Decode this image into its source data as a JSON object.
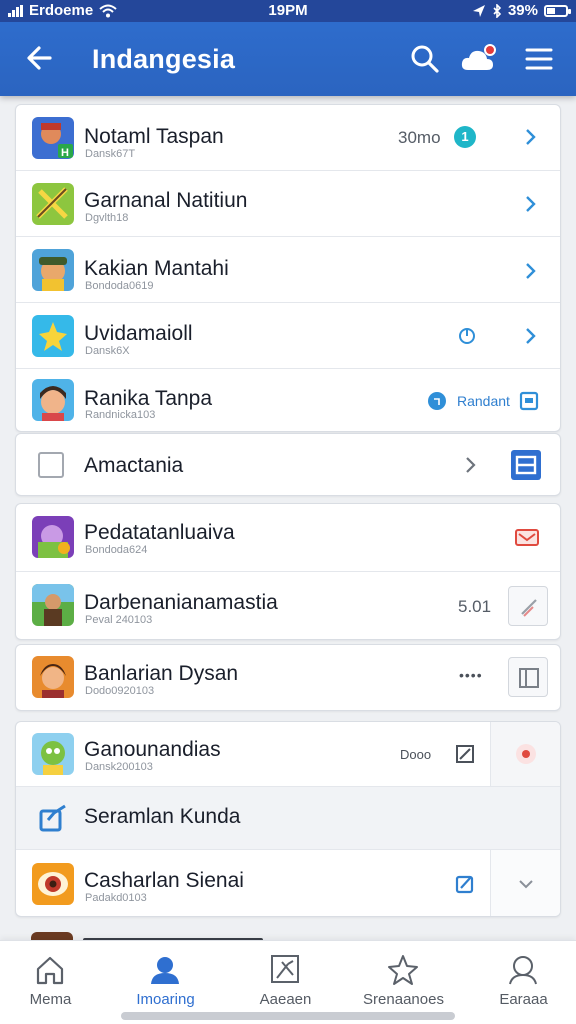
{
  "status_bar": {
    "carrier": "Erdoeme",
    "time": "19PM",
    "battery": "39%"
  },
  "app_bar": {
    "title": "Indangesia"
  },
  "list_group_1": [
    {
      "title": "Notaml Taspan",
      "subtitle": "Dansk67T",
      "meta": "30mo",
      "badge": "1"
    },
    {
      "title": "Garnanal Natitiun",
      "subtitle": "Dgvlth18",
      "meta": "",
      "badge": ""
    },
    {
      "title": "Kakian Mantahi",
      "subtitle": "Bondoda0619",
      "meta": "",
      "badge": ""
    },
    {
      "title": "Uvidamaioll",
      "subtitle": "Dansk6X",
      "meta": "",
      "badge": ""
    },
    {
      "title": "Ranika Tanpa",
      "subtitle": "Randnicka103",
      "meta": "Randant",
      "badge": ""
    }
  ],
  "checkbox_row": {
    "title": "Amactania"
  },
  "list_group_2": [
    {
      "title": "Pedatatanluaiva",
      "subtitle": "Bondoda624"
    },
    {
      "title": "Darbenanianamastia",
      "subtitle": "Peval 240103",
      "meta": "5.01"
    }
  ],
  "list_group_3": [
    {
      "title": "Banlarian Dysan",
      "subtitle": "Dodo0920103",
      "meta": "••••"
    }
  ],
  "list_group_4": [
    {
      "title": "Ganounandias",
      "subtitle": "Dansk200103",
      "meta": "Dooo"
    },
    {
      "title": "Seramlan Kunda"
    },
    {
      "title": "Casharlan Sienai",
      "subtitle": "Padakd0103"
    }
  ],
  "bottom_nav": [
    {
      "label": "Mema"
    },
    {
      "label": "Imoaring"
    },
    {
      "label": "Aaeaen"
    },
    {
      "label": "Srenaanoes"
    },
    {
      "label": "Earaaa"
    }
  ],
  "colors": {
    "primary": "#2f6fd0",
    "accent_teal": "#1fb6c8",
    "danger": "#e33b3b"
  }
}
